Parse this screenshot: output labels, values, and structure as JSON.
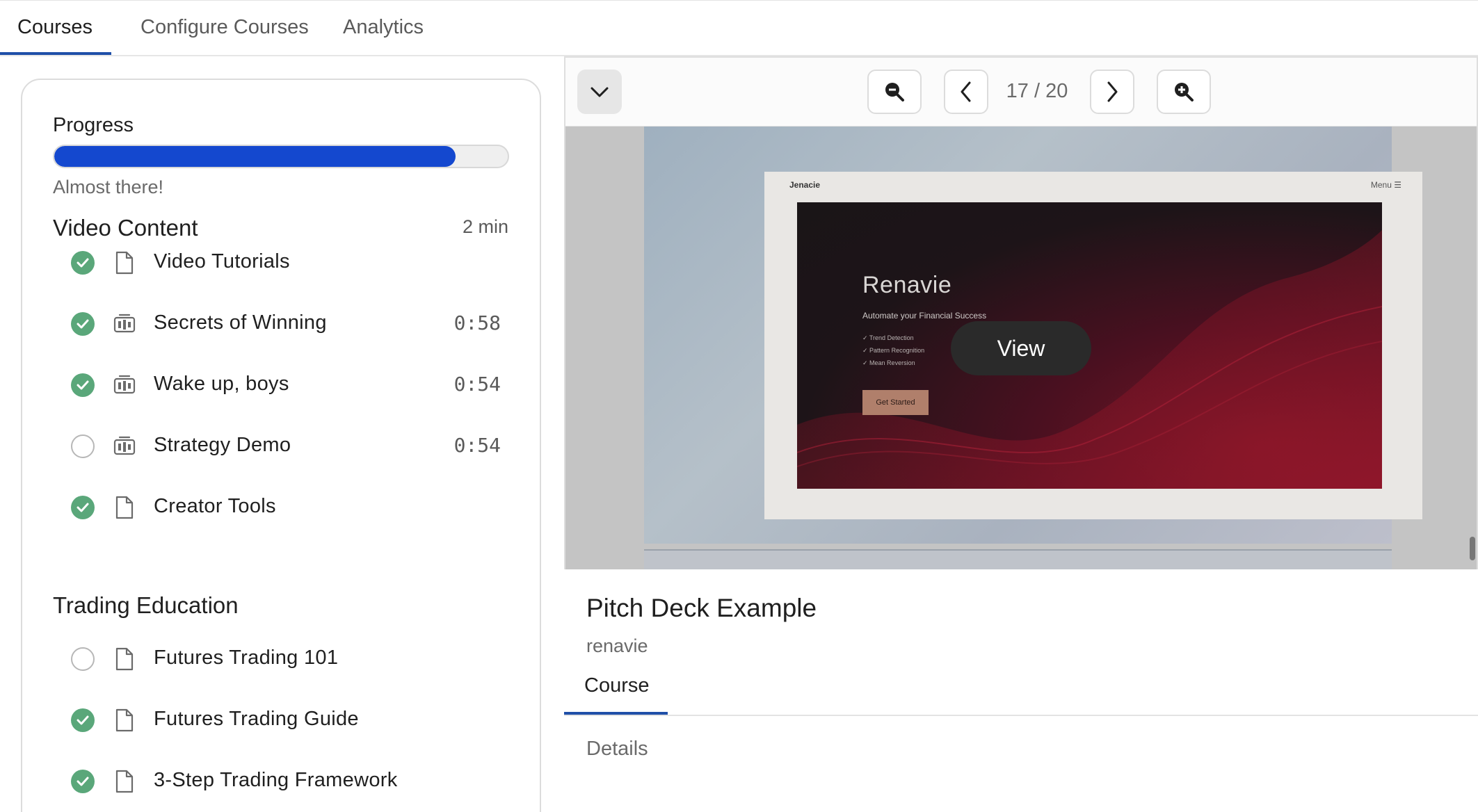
{
  "tabs": [
    {
      "label": "Courses",
      "active": true
    },
    {
      "label": "Configure Courses",
      "active": false
    },
    {
      "label": "Analytics",
      "active": false
    }
  ],
  "progress": {
    "label": "Progress",
    "fraction": 0.885,
    "message": "Almost there!",
    "fill_color": "#1448cf"
  },
  "sections": [
    {
      "title": "Video Content",
      "duration": "2 min",
      "lessons": [
        {
          "title": "Video Tutorials",
          "type": "document-icon",
          "done": true,
          "duration": ""
        },
        {
          "title": "Secrets of Winning",
          "type": "video-icon",
          "done": true,
          "duration": "0:58"
        },
        {
          "title": "Wake up, boys",
          "type": "video-icon",
          "done": true,
          "duration": "0:54"
        },
        {
          "title": "Strategy Demo",
          "type": "video-icon",
          "done": false,
          "duration": "0:54"
        },
        {
          "title": "Creator Tools",
          "type": "document-icon",
          "done": true,
          "duration": ""
        }
      ]
    },
    {
      "title": "Trading Education",
      "duration": "",
      "lessons": [
        {
          "title": "Futures Trading 101",
          "type": "document-icon",
          "done": false,
          "duration": ""
        },
        {
          "title": "Futures Trading Guide",
          "type": "document-icon",
          "done": true,
          "duration": ""
        },
        {
          "title": "3-Step Trading Framework",
          "type": "document-icon",
          "done": true,
          "duration": ""
        }
      ]
    }
  ],
  "viewer": {
    "page_current": 17,
    "page_total": 20,
    "page_label": "17 / 20",
    "icons": {
      "collapse": "chevron-down-icon",
      "zoom_out": "zoom-out-icon",
      "prev": "chevron-left-icon",
      "next": "chevron-right-icon",
      "zoom_in": "zoom-in-icon"
    },
    "view_button_label": "View",
    "slide": {
      "nav_logo": "Jenacie",
      "nav_menu": "Menu ☰",
      "hero_title": "Renavie",
      "hero_subtitle": "Automate your Financial Success",
      "features": [
        "Trend Detection",
        "Pattern Recognition",
        "Mean Reversion"
      ],
      "cta": "Get Started"
    }
  },
  "document": {
    "title": "Pitch Deck Example",
    "author": "renavie",
    "tabs": [
      {
        "label": "Course",
        "active": true
      }
    ],
    "details_heading": "Details"
  },
  "colors": {
    "accent": "#1f4fa8",
    "done_check": "#5aa77a",
    "view_pill": "#2a2a2a"
  }
}
